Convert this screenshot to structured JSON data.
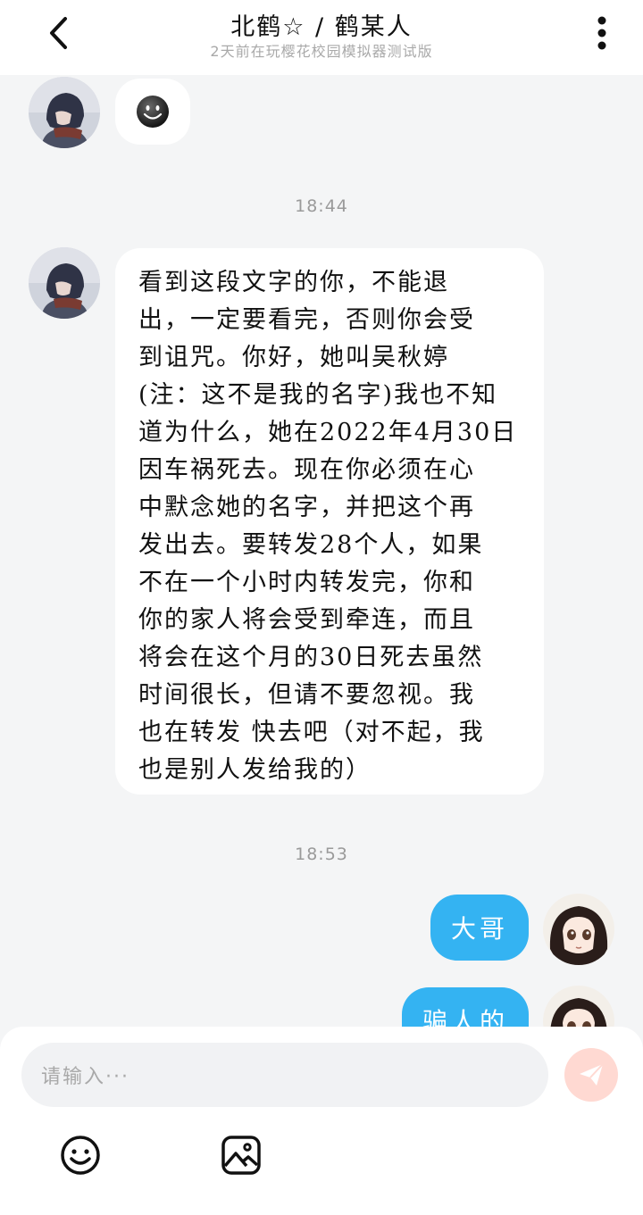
{
  "header": {
    "title": "北鹤☆ / 鹤某人",
    "subtitle": "2天前在玩樱花校园模拟器测试版"
  },
  "messages": {
    "first": {
      "sender": "incoming",
      "content_icon": "smiling-face-emoji"
    },
    "time_1": "18:44",
    "long": {
      "sender": "incoming",
      "lines": [
        "看到这段文字的你，不能退",
        "出，一定要看完，否则你会受",
        "到诅咒。你好，她叫吴秋婷",
        "(注：这不是我的名字)我也不知",
        "道为什么，她在2022年4月30日",
        "因车祸死去。现在你必须在心",
        "中默念她的名字，并把这个再",
        "发出去。要转发28个人，如果",
        "不在一个小时内转发完，你和",
        "你的家人将会受到牵连，而且",
        "将会在这个月的30日死去虽然",
        "时间很长，但请不要忽视。我",
        "也在转发 快去吧（对不起，我",
        "也是别人发给我的）"
      ]
    },
    "time_2": "18:53",
    "out_1": {
      "sender": "outgoing",
      "text": "大哥"
    },
    "out_2": {
      "sender": "outgoing",
      "text": "骗人的"
    }
  },
  "composer": {
    "placeholder": "请输入···",
    "icons": [
      "emoji-icon",
      "image-icon",
      "send-icon"
    ]
  },
  "colors": {
    "accent": "#34b3f2",
    "background": "#f4f5f6",
    "send_disabled": "#ffd9d2"
  }
}
